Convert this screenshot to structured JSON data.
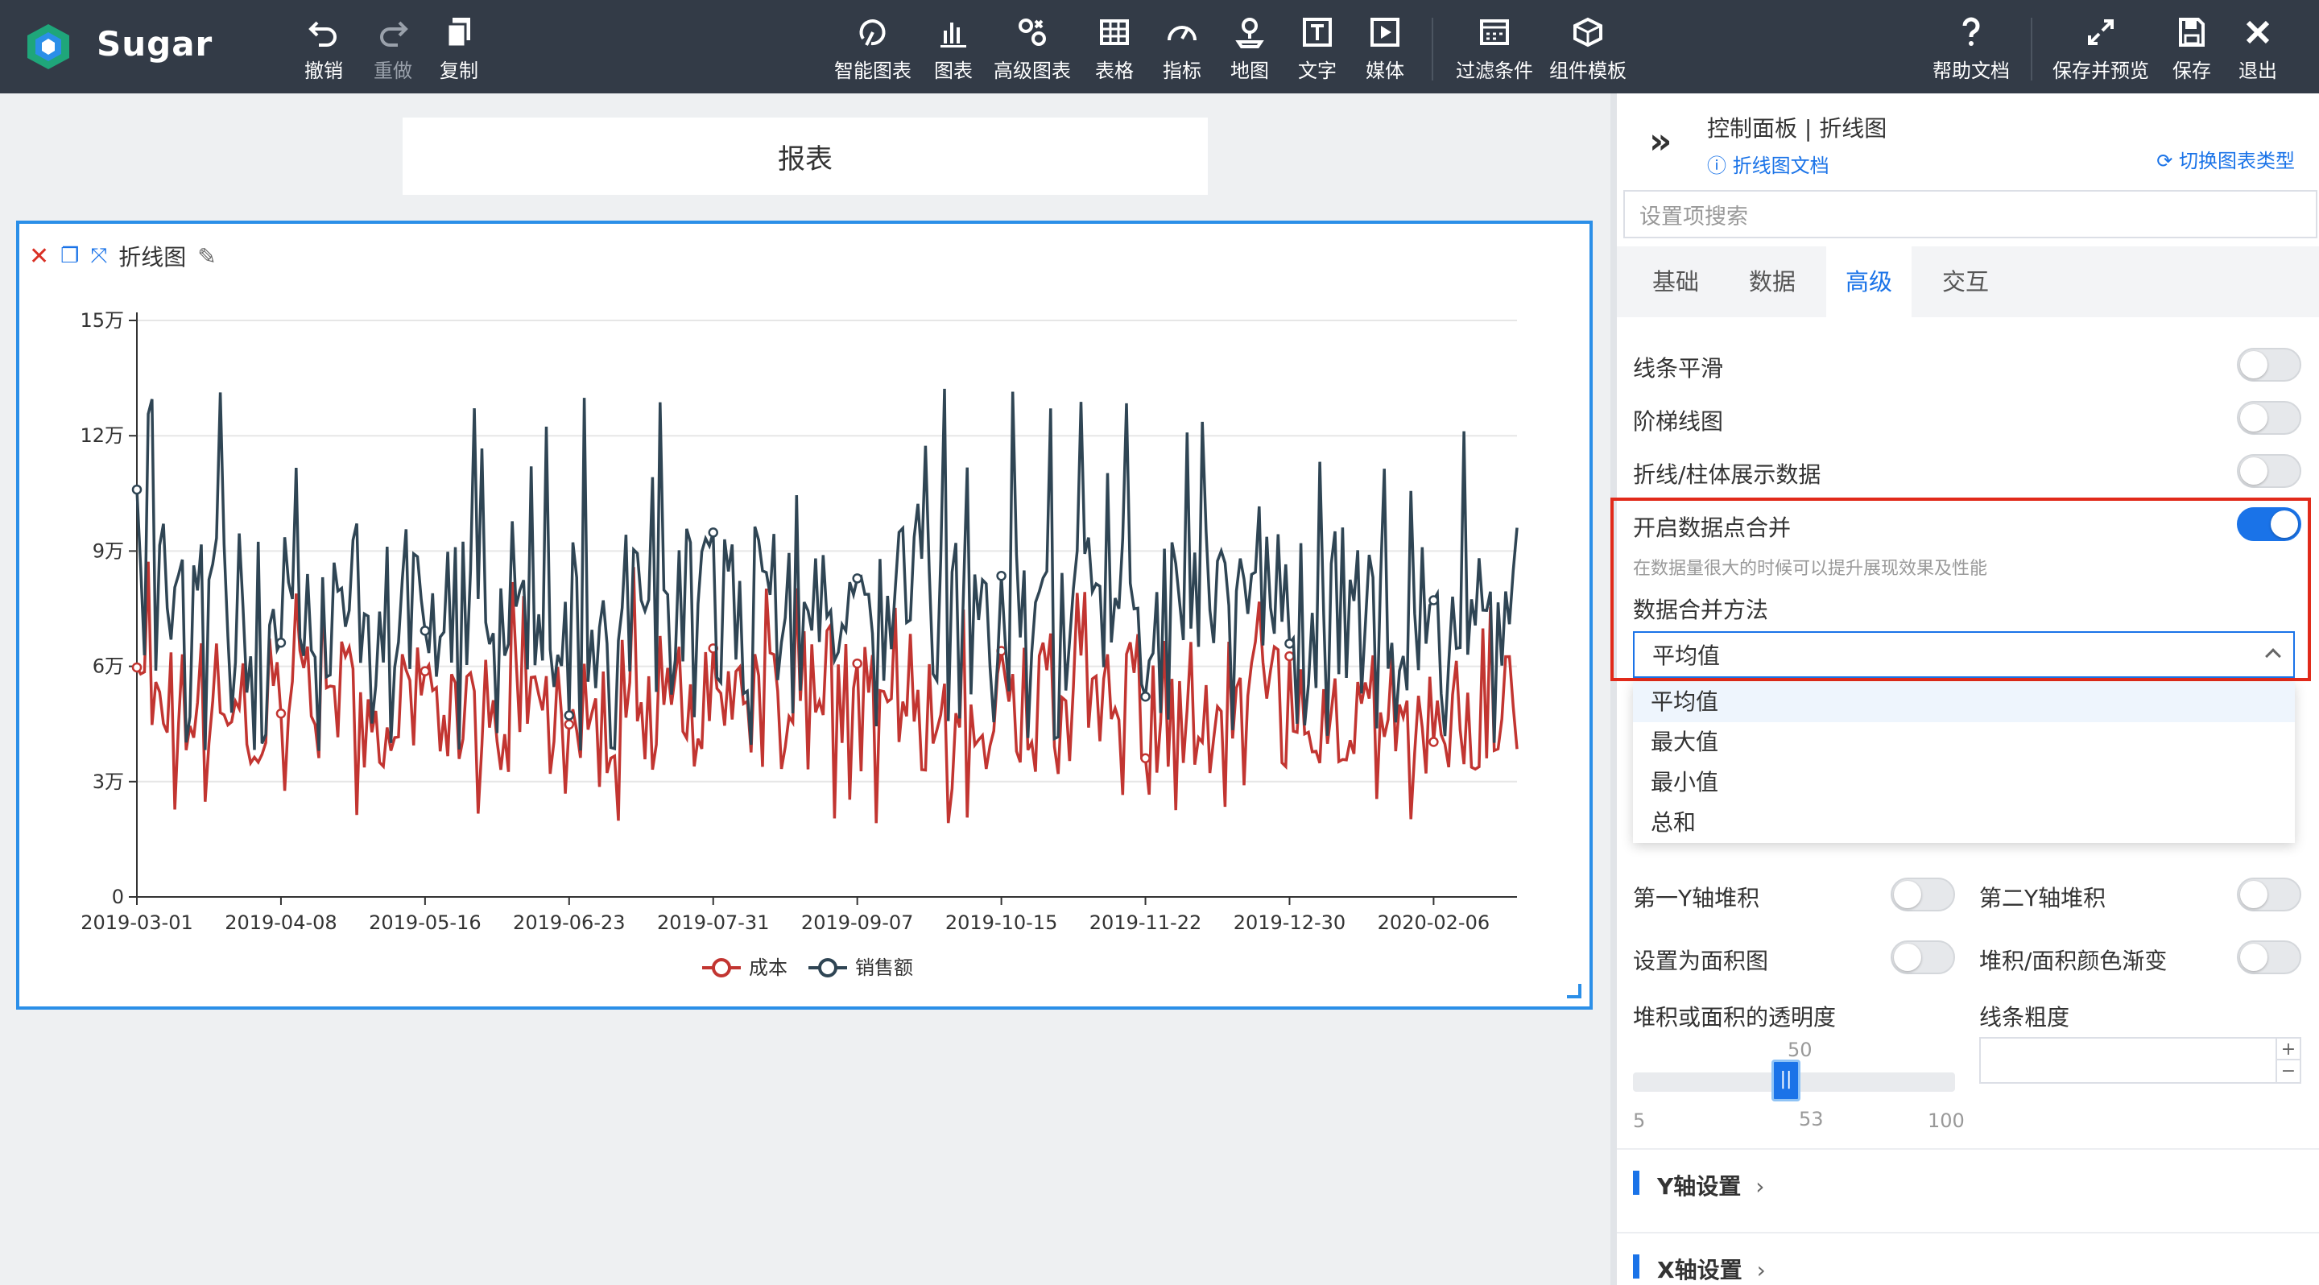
{
  "app": {
    "name": "Sugar"
  },
  "toolbar": {
    "undo": "撤销",
    "redo": "重做",
    "copy": "复制",
    "smart_chart": "智能图表",
    "chart": "图表",
    "advanced_chart": "高级图表",
    "table": "表格",
    "indicator": "指标",
    "map": "地图",
    "text": "文字",
    "media": "媒体",
    "filter": "过滤条件",
    "component_template": "组件模板",
    "help": "帮助文档",
    "save_preview": "保存并预览",
    "save": "保存",
    "exit": "退出"
  },
  "canvas": {
    "report_title": "报表",
    "card_title": "折线图"
  },
  "chart_data": {
    "type": "line",
    "y_ticks": [
      "0",
      "3万",
      "6万",
      "9万",
      "12万",
      "15万"
    ],
    "ylim": [
      0,
      150000
    ],
    "x_tick_labels": [
      "2019-03-01",
      "2019-04-08",
      "2019-05-16",
      "2019-06-23",
      "2019-07-31",
      "2019-09-07",
      "2019-10-15",
      "2019-11-22",
      "2019-12-30",
      "2020-02-06"
    ],
    "x_range": [
      "2019-03-01",
      "2020-02-28"
    ],
    "legend_position": "bottom-center",
    "grid": true,
    "series": [
      {
        "name": "成本",
        "color": "#c23531"
      },
      {
        "name": "销售额",
        "color": "#2f4554"
      }
    ],
    "note": "daily values (~365 points), sales fluctuating ~40k–135k, cost ~20k–100k"
  },
  "panel": {
    "title": "控制面板 | 折线图",
    "doc_link": "折线图文档",
    "switch_type": "切换图表类型",
    "search_placeholder": "设置项搜索",
    "tabs": [
      "基础",
      "数据",
      "高级",
      "交互"
    ],
    "active_tab": "高级",
    "line_smooth": "线条平滑",
    "step_line": "阶梯线图",
    "show_data": "折线/柱体展示数据",
    "merge_points": "开启数据点合并",
    "merge_hint": "在数据量很大的时候可以提升展现效果及性能",
    "merge_method_label": "数据合并方法",
    "merge_method_value": "平均值",
    "merge_options": [
      "平均值",
      "最大值",
      "最小值",
      "总和"
    ],
    "y1_stack": "第一Y轴堆积",
    "y2_stack": "第二Y轴堆积",
    "area": "设置为面积图",
    "gradient": "堆积/面积颜色渐变",
    "opacity_label": "堆积或面积的透明度",
    "line_width_label": "线条粗度",
    "opacity_value": "50",
    "slider_min": "5",
    "slider_mid": "53",
    "slider_max": "100",
    "y_axis": "Y轴设置",
    "x_axis": "X轴设置"
  }
}
